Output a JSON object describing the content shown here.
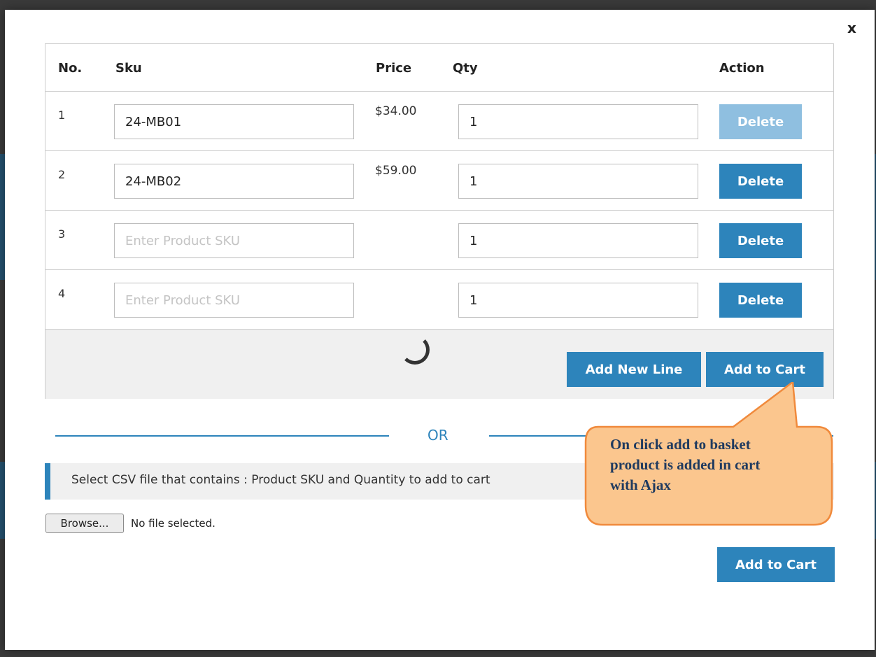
{
  "dialog": {
    "close_label": "x"
  },
  "table": {
    "headers": {
      "no": "No.",
      "sku": "Sku",
      "price": "Price",
      "qty": "Qty",
      "action": "Action"
    },
    "rows": [
      {
        "no": "1",
        "sku": "24-MB01",
        "sku_placeholder": "Enter Product SKU",
        "price": "$34.00",
        "qty": "1",
        "delete_label": "Delete",
        "delete_disabled": true
      },
      {
        "no": "2",
        "sku": "24-MB02",
        "sku_placeholder": "Enter Product SKU",
        "price": "$59.00",
        "qty": "1",
        "delete_label": "Delete",
        "delete_disabled": false
      },
      {
        "no": "3",
        "sku": "",
        "sku_placeholder": "Enter Product SKU",
        "price": "",
        "qty": "1",
        "delete_label": "Delete",
        "delete_disabled": false
      },
      {
        "no": "4",
        "sku": "",
        "sku_placeholder": "Enter Product SKU",
        "price": "",
        "qty": "1",
        "delete_label": "Delete",
        "delete_disabled": false
      }
    ],
    "add_new_line_label": "Add New Line",
    "add_to_cart_label": "Add to Cart"
  },
  "separator": {
    "or_label": "OR"
  },
  "csv": {
    "note": "Select CSV file that contains : Product SKU and Quantity to add to cart",
    "browse_label": "Browse...",
    "file_status": "No file selected.",
    "add_to_cart_label": "Add to Cart"
  },
  "callout": {
    "line1": "On click add to basket",
    "line2": "product is added in cart",
    "line3": "with Ajax"
  },
  "colors": {
    "primary": "#2d84bb",
    "primary_disabled": "#8fbfe0",
    "callout_fill": "#fbc68e",
    "callout_stroke": "#f08a3c"
  }
}
